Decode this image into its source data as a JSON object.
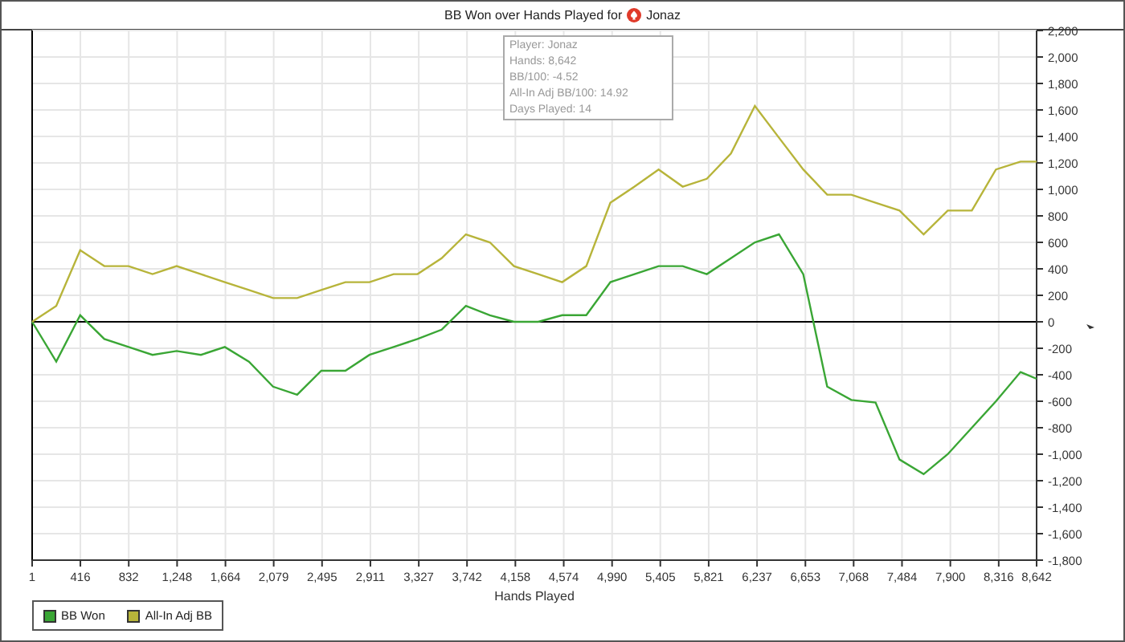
{
  "title": "BB Won over Hands Played for",
  "title_player": "Jonaz",
  "tooltip": {
    "lines": [
      "Player: Jonaz",
      "Hands: 8,642",
      "BB/100: -4.52",
      "All-In Adj BB/100: 14.92",
      "Days Played: 14"
    ]
  },
  "chart_data": {
    "type": "line",
    "xlabel": "Hands Played",
    "x": [
      1,
      208,
      415,
      622,
      830,
      1037,
      1244,
      1452,
      1659,
      1866,
      2073,
      2281,
      2488,
      2695,
      2903,
      3110,
      3317,
      3524,
      3732,
      3939,
      4146,
      4354,
      4561,
      4768,
      4975,
      5183,
      5390,
      5597,
      5805,
      6012,
      6219,
      6426,
      6634,
      6841,
      7048,
      7256,
      7463,
      7670,
      7877,
      8085,
      8292,
      8504,
      8642
    ],
    "series": [
      {
        "name": "BB Won",
        "color": "#3aa635",
        "values": [
          0,
          -300,
          50,
          -130,
          -190,
          -250,
          -220,
          -250,
          -190,
          -300,
          -490,
          -550,
          -370,
          -370,
          -250,
          -190,
          -130,
          -60,
          120,
          50,
          0,
          0,
          50,
          50,
          300,
          360,
          420,
          420,
          360,
          480,
          600,
          660,
          360,
          -490,
          -590,
          -610,
          -1040,
          -1150,
          -1000,
          -800,
          -600,
          -380,
          -430
        ]
      },
      {
        "name": "All-In Adj BB",
        "color": "#b7b43a",
        "values": [
          0,
          120,
          540,
          420,
          420,
          360,
          420,
          360,
          300,
          240,
          180,
          180,
          240,
          300,
          300,
          360,
          360,
          480,
          660,
          600,
          420,
          360,
          300,
          420,
          900,
          1020,
          1150,
          1020,
          1080,
          1270,
          1630,
          1390,
          1150,
          960,
          960,
          900,
          840,
          660,
          840,
          840,
          1150,
          1210,
          1210
        ]
      }
    ],
    "grid": true,
    "xlim": [
      1,
      8642
    ],
    "ylim": [
      -1800,
      2200
    ],
    "xticks": [
      {
        "value": 1,
        "label": "1"
      },
      {
        "value": 416,
        "label": "416"
      },
      {
        "value": 832,
        "label": "832"
      },
      {
        "value": 1248,
        "label": "1,248"
      },
      {
        "value": 1664,
        "label": "1,664"
      },
      {
        "value": 2079,
        "label": "2,079"
      },
      {
        "value": 2495,
        "label": "2,495"
      },
      {
        "value": 2911,
        "label": "2,911"
      },
      {
        "value": 3327,
        "label": "3,327"
      },
      {
        "value": 3742,
        "label": "3,742"
      },
      {
        "value": 4158,
        "label": "4,158"
      },
      {
        "value": 4574,
        "label": "4,574"
      },
      {
        "value": 4990,
        "label": "4,990"
      },
      {
        "value": 5405,
        "label": "5,405"
      },
      {
        "value": 5821,
        "label": "5,821"
      },
      {
        "value": 6237,
        "label": "6,237"
      },
      {
        "value": 6653,
        "label": "6,653"
      },
      {
        "value": 7068,
        "label": "7,068"
      },
      {
        "value": 7484,
        "label": "7,484"
      },
      {
        "value": 7900,
        "label": "7,900"
      },
      {
        "value": 8316,
        "label": "8,316"
      },
      {
        "value": 8642,
        "label": "8,642"
      }
    ],
    "yticks": [
      {
        "value": 2200,
        "label": "2,200"
      },
      {
        "value": 2000,
        "label": "2,000"
      },
      {
        "value": 1800,
        "label": "1,800"
      },
      {
        "value": 1600,
        "label": "1,600"
      },
      {
        "value": 1400,
        "label": "1,400"
      },
      {
        "value": 1200,
        "label": "1,200"
      },
      {
        "value": 1000,
        "label": "1,000"
      },
      {
        "value": 800,
        "label": "800"
      },
      {
        "value": 600,
        "label": "600"
      },
      {
        "value": 400,
        "label": "400"
      },
      {
        "value": 200,
        "label": "200"
      },
      {
        "value": 0,
        "label": "0"
      },
      {
        "value": -200,
        "label": "-200"
      },
      {
        "value": -400,
        "label": "-400"
      },
      {
        "value": -600,
        "label": "-600"
      },
      {
        "value": -800,
        "label": "-800"
      },
      {
        "value": -1000,
        "label": "-1,000"
      },
      {
        "value": -1200,
        "label": "-1,200"
      },
      {
        "value": -1400,
        "label": "-1,400"
      },
      {
        "value": -1600,
        "label": "-1,600"
      },
      {
        "value": -1800,
        "label": "-1,800"
      }
    ]
  }
}
